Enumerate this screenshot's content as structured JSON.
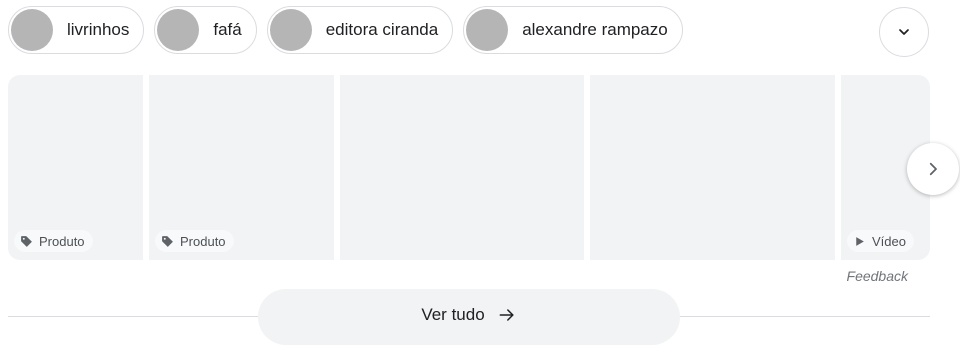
{
  "chips": [
    {
      "label": "livrinhos"
    },
    {
      "label": "fafá"
    },
    {
      "label": "editora ciranda"
    },
    {
      "label": "alexandre rampazo"
    }
  ],
  "expand_button": {
    "icon": "chevron-down-icon"
  },
  "carousel": {
    "cards": [
      {
        "tag_label": "Produto",
        "tag_icon": "tag-icon"
      },
      {
        "tag_label": "Produto",
        "tag_icon": "tag-icon"
      },
      {
        "tag_label": ""
      },
      {
        "tag_label": ""
      },
      {
        "tag_label": "Vídeo",
        "tag_icon": "play-icon"
      }
    ],
    "next_icon": "chevron-right-icon"
  },
  "feedback_label": "Feedback",
  "see_all": {
    "label": "Ver tudo",
    "icon": "arrow-right-icon"
  },
  "colors": {
    "card_bg": "#f1f3f4",
    "border": "#dadce0",
    "avatar": "#b5b5b5"
  }
}
